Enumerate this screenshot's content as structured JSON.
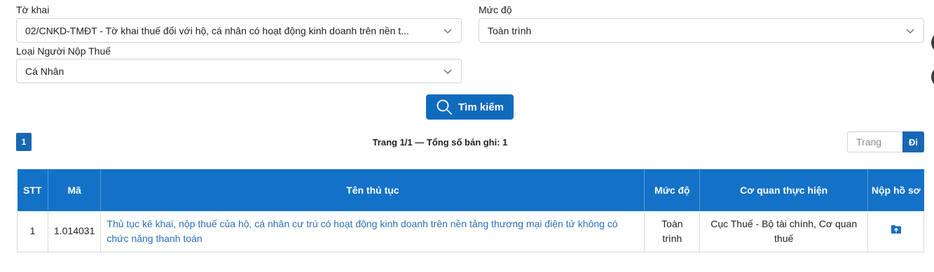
{
  "filters": {
    "to_khai": {
      "label": "Tờ khai",
      "value": "02/CNKD-TMĐT - Tờ khai thuế đối với hộ, cá nhân có hoạt động kinh doanh trên nền t..."
    },
    "muc_do": {
      "label": "Mức độ",
      "value": "Toàn trình"
    },
    "loai_nguoi_nop_thue": {
      "label": "Loại Người Nộp Thuế",
      "value": "Cá Nhân"
    }
  },
  "search_button": {
    "label": "Tìm kiếm",
    "icon": "search-icon"
  },
  "pagination": {
    "current_page": "1",
    "info": "Trang 1/1 — Tổng số bản ghi: 1",
    "input_placeholder": "Trang",
    "go_label": "Đi"
  },
  "table": {
    "headers": [
      "STT",
      "Mã",
      "Tên thủ tục",
      "Mức độ",
      "Cơ quan thực hiện",
      "Nộp hồ sơ"
    ],
    "rows": [
      {
        "stt": "1",
        "ma": "1.014031",
        "ten_thu_tuc": "Thủ tục kê khai, nộp thuế của hộ, cá nhân cư trú có hoạt động kinh doanh trên nền tảng thương mại điện tử không có chức năng thanh toán",
        "muc_do": "Toàn trình",
        "co_quan": "Cục Thuế - Bộ tài chính, Cơ quan thuế",
        "nop_ho_so_icon": "folder-upload-icon"
      }
    ]
  },
  "colors": {
    "primary": "#1371c7",
    "button": "#0f6bbd",
    "link": "#2a6fb8"
  }
}
